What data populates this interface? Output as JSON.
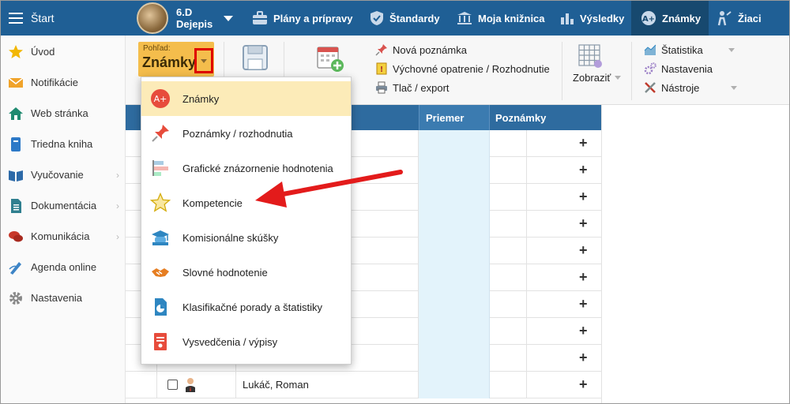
{
  "topbar": {
    "menu_label": "Štart",
    "class_name": "6.D",
    "subject": "Dejepis",
    "nav": [
      {
        "label": "Plány a prípravy",
        "icon": "briefcase-icon"
      },
      {
        "label": "Štandardy",
        "icon": "shield-check-icon"
      },
      {
        "label": "Moja knižnica",
        "icon": "library-icon"
      },
      {
        "label": "Výsledky",
        "icon": "bar-chart-icon"
      },
      {
        "label": "Známky",
        "icon": "grade-icon"
      },
      {
        "label": "Žiaci",
        "icon": "students-icon"
      }
    ],
    "active": "Známky",
    "bg_color": "#1f5f95",
    "active_color": "#17496f"
  },
  "sidebar": {
    "items": [
      {
        "label": "Úvod",
        "icon": "star-icon",
        "has_sub": false
      },
      {
        "label": "Notifikácie",
        "icon": "envelope-icon",
        "has_sub": false
      },
      {
        "label": "Web stránka",
        "icon": "house-icon",
        "has_sub": false
      },
      {
        "label": "Triedna kniha",
        "icon": "book-icon",
        "has_sub": false
      },
      {
        "label": "Vyučovanie",
        "icon": "open-book-icon",
        "has_sub": true
      },
      {
        "label": "Dokumentácia",
        "icon": "document-icon",
        "has_sub": true
      },
      {
        "label": "Komunikácia",
        "icon": "chat-icon",
        "has_sub": true
      },
      {
        "label": "Agenda online",
        "icon": "pen-icon",
        "has_sub": false
      },
      {
        "label": "Nastavenia",
        "icon": "gear-icon",
        "has_sub": false
      }
    ]
  },
  "ribbon": {
    "view_label": "Pohľad:",
    "view_value": "Známky",
    "col_a": [
      {
        "label": "Nová poznámka",
        "icon": "pin-icon"
      },
      {
        "label": "Výchovné opatrenie / Rozhodnutie",
        "icon": "warning-note-icon"
      },
      {
        "label": "Tlač / export",
        "icon": "printer-icon"
      }
    ],
    "zobrazit": "Zobraziť",
    "col_b": [
      {
        "label": "Štatistika",
        "icon": "area-chart-icon",
        "has_menu": true
      },
      {
        "label": "Nastavenia",
        "icon": "gears-icon",
        "has_menu": false
      },
      {
        "label": "Nástroje",
        "icon": "tools-icon",
        "has_menu": true
      }
    ]
  },
  "table": {
    "headers": {
      "priemer": "Priemer",
      "poznamky": "Poznámky"
    },
    "last_student": "Lukáč, Roman",
    "plus_symbol": "+"
  },
  "dropdown": {
    "items": [
      {
        "label": "Známky",
        "icon": "grade-badge-icon",
        "selected": true
      },
      {
        "label": "Poznámky / rozhodnutia",
        "icon": "pushpin-icon",
        "selected": false
      },
      {
        "label": "Grafické znázornenie hodnotenia",
        "icon": "bars-icon",
        "selected": false
      },
      {
        "label": "Kompetencie",
        "icon": "star-outline-icon",
        "selected": false
      },
      {
        "label": "Komisionálne skúšky",
        "icon": "graduation-icon",
        "selected": false
      },
      {
        "label": "Slovné hodnotenie",
        "icon": "handshake-icon",
        "selected": false
      },
      {
        "label": "Klasifikačné porady a štatistiky",
        "icon": "pie-doc-icon",
        "selected": false
      },
      {
        "label": "Vysvedčenia / výpisy",
        "icon": "certificate-icon",
        "selected": false
      }
    ]
  }
}
